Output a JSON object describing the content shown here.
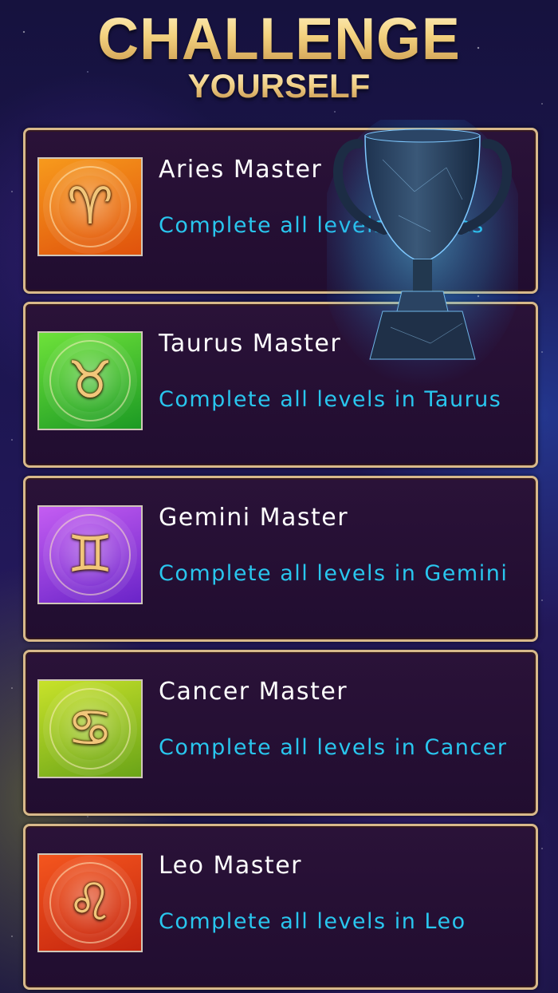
{
  "header": {
    "title": "CHALLENGE",
    "subtitle": "YOURSELF"
  },
  "colors": {
    "title_gold": "#f2d48a",
    "card_border": "#d8b98a",
    "card_bg": "#230f33",
    "title_text": "#ffffff",
    "desc_text": "#29c6ee"
  },
  "achievements": [
    {
      "title": "Aries Master",
      "description": "Complete all levels in Aries",
      "icon": "aries-icon",
      "glyph": "♈",
      "color_top": "#f79a1c",
      "color_bottom": "#e0520c"
    },
    {
      "title": "Taurus Master",
      "description": "Complete all levels in Taurus",
      "icon": "taurus-icon",
      "glyph": "♉",
      "color_top": "#6ee23a",
      "color_bottom": "#1c9a24"
    },
    {
      "title": "Gemini Master",
      "description": "Complete all levels in Gemini",
      "icon": "gemini-icon",
      "glyph": "♊",
      "color_top": "#c45df2",
      "color_bottom": "#6a24c8"
    },
    {
      "title": "Cancer Master",
      "description": "Complete all levels in Cancer",
      "icon": "cancer-icon",
      "glyph": "♋",
      "color_top": "#c8e22a",
      "color_bottom": "#6aa418"
    },
    {
      "title": "Leo Master",
      "description": "Complete all levels in Leo",
      "icon": "leo-icon",
      "glyph": "♌",
      "color_top": "#f4561e",
      "color_bottom": "#c4240e"
    }
  ],
  "trophy": {
    "icon": "trophy-icon",
    "glow_color": "#4fd0ff"
  }
}
